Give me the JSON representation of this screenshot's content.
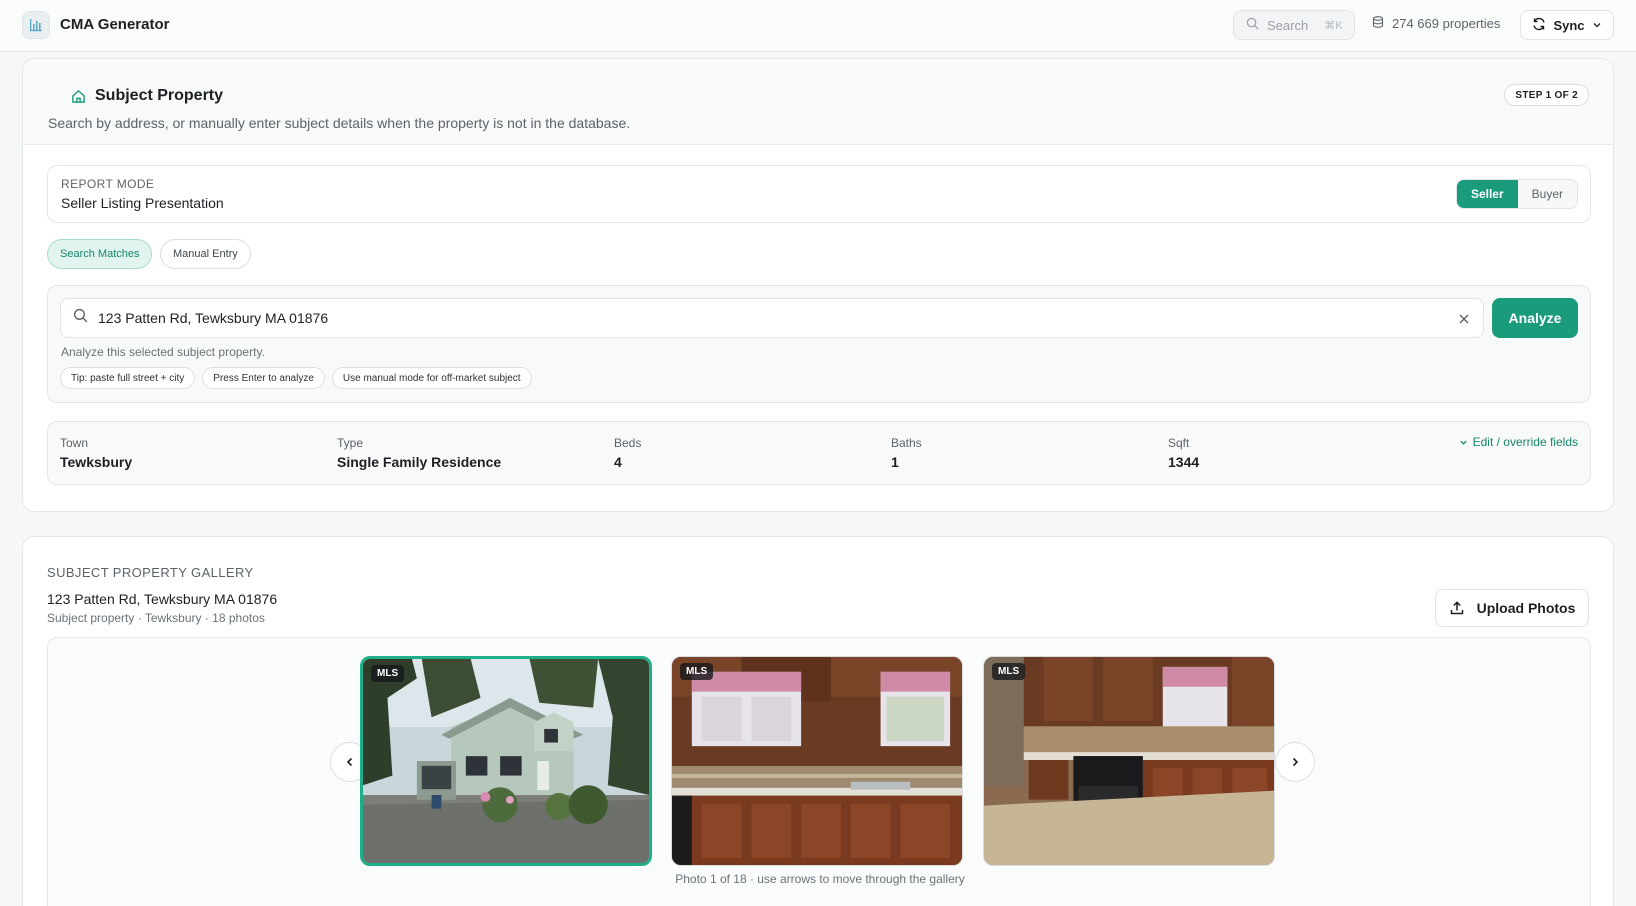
{
  "app": {
    "title": "CMA Generator",
    "search_placeholder": "Search",
    "search_shortcut": "⌘K",
    "property_count": "274 669 properties",
    "sync_label": "Sync"
  },
  "subject": {
    "title": "Subject Property",
    "description": "Search by address, or manually enter subject details when the property is not in the database.",
    "step_badge": "STEP 1 OF 2",
    "report_mode_label": "REPORT MODE",
    "report_mode_value": "Seller Listing Presentation",
    "mode_options": [
      "Seller",
      "Buyer"
    ],
    "tabs": [
      "Search Matches",
      "Manual Entry"
    ],
    "address_value": "123 Patten Rd, Tewksbury MA 01876",
    "analyze_label": "Analyze",
    "helper_text": "Analyze this selected subject property.",
    "chips": [
      "Tip: paste full street + city",
      "Press Enter to analyze",
      "Use manual mode for off-market subject"
    ],
    "facts": [
      {
        "label": "Town",
        "value": "Tewksbury"
      },
      {
        "label": "Type",
        "value": "Single Family Residence"
      },
      {
        "label": "Beds",
        "value": "4"
      },
      {
        "label": "Baths",
        "value": "1"
      },
      {
        "label": "Sqft",
        "value": "1344"
      }
    ],
    "edit_link": "Edit / override fields"
  },
  "gallery": {
    "title": "SUBJECT PROPERTY GALLERY",
    "address": "123 Patten Rd, Tewksbury MA 01876",
    "subtitle": "Subject property · Tewksbury · 18 photos",
    "upload_label": "Upload Photos",
    "photo_tag": "MLS",
    "caption": "Photo 1 of 18 · use arrows to move through the gallery"
  },
  "colors": {
    "accent": "#1a9b7c",
    "accent_light": "#e2f4ef"
  }
}
